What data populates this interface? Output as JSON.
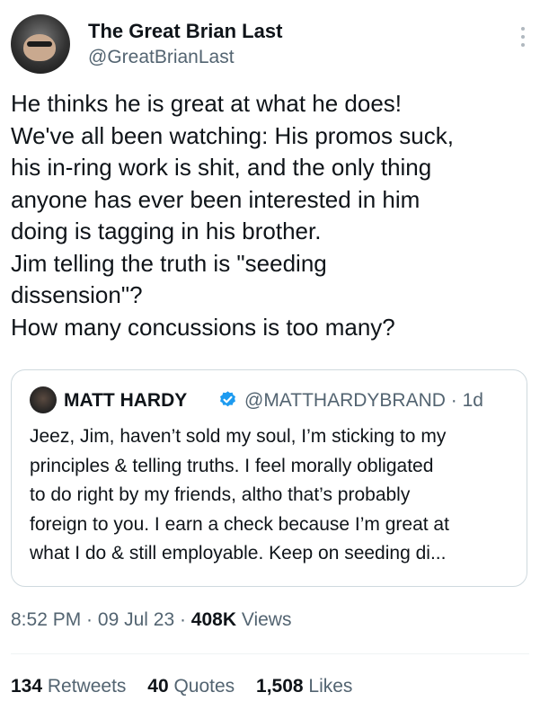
{
  "author": {
    "name": "The Great Brian Last",
    "handle": "@GreatBrianLast"
  },
  "tweet": {
    "lines": [
      "He thinks he is great at what he does!",
      "We've all been watching: His promos suck,",
      "his in-ring work is shit, and the only thing",
      "anyone has ever been interested in him",
      "doing is tagging in his brother.",
      "Jim telling the truth is \"seeding",
      "dissension\"?",
      "How many concussions is too many?"
    ]
  },
  "quoted": {
    "name": "MATT HARDY",
    "verified_icon": "verified-badge-icon",
    "handle": "@MATTHARDYBRAND · 1d",
    "lines": [
      "Jeez, Jim, haven’t sold my soul, I’m sticking to my",
      "principles & telling truths. I feel morally obligated",
      "to do right by my friends, altho that’s probably",
      "foreign to you. I earn a check because I’m great at",
      "what I do & still employable. Keep on seeding di..."
    ]
  },
  "meta": {
    "time": "8:52 PM",
    "sep1": " · ",
    "date": "09 Jul 23",
    "sep2": " · ",
    "views_count": "408K",
    "views_label": " Views"
  },
  "stats": {
    "retweets_count": "134",
    "retweets_label": " Retweets",
    "quotes_count": "40",
    "quotes_label": " Quotes",
    "likes_count": "1,508",
    "likes_label": " Likes"
  },
  "colors": {
    "verified_blue": "#1d9bf0",
    "secondary_text": "#536471"
  }
}
